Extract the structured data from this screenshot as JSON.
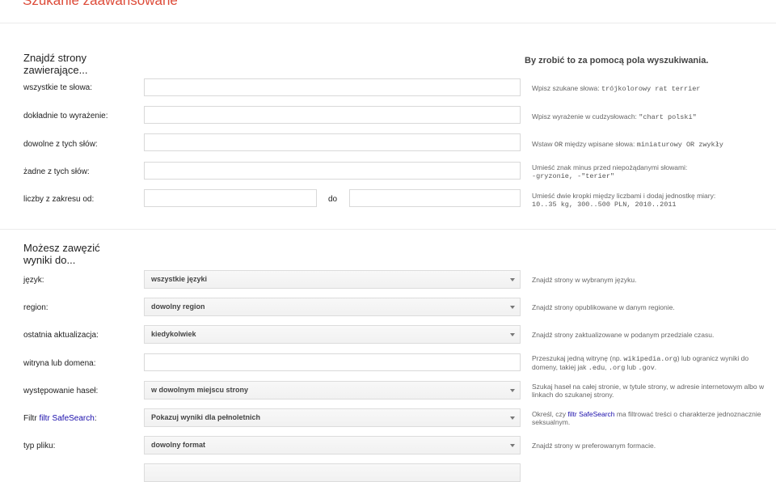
{
  "page": {
    "title": "Szukanie zaawansowane"
  },
  "find_section": {
    "heading": "Znajdź strony zawierające...",
    "right_heading": "By zrobić to za pomocą pola wyszukiwania.",
    "rows": [
      {
        "label": "wszystkie te słowa:",
        "hint_prefix": "Wpisz szukane słowa: ",
        "hint_code": "trójkolorowy rat terrier"
      },
      {
        "label": "dokładnie to wyrażenie:",
        "hint_prefix": "Wpisz wyrażenie w cudzysłowach: ",
        "hint_code": "\"chart polski\""
      },
      {
        "label": "dowolne z tych słów:",
        "hint_prefix": "Wstaw ",
        "hint_code": "OR",
        "hint_middle": " między wpisane słowa: ",
        "hint_code2": "miniaturowy OR zwykły"
      },
      {
        "label": "żadne z tych słów:",
        "hint_prefix": "Umieść znak minus przed niepożądanymi słowami:",
        "hint_code": "-gryzonie, -\"terier\""
      },
      {
        "label": "liczby z zakresu od:",
        "to_label": "do",
        "hint_prefix": "Umieść dwie kropki między liczbami i dodaj jednostkę miary:",
        "hint_code": "10..35 kg, 300..500 PLN, 2010..2011"
      }
    ]
  },
  "narrow_section": {
    "heading": "Możesz zawęzić wyniki do...",
    "rows": [
      {
        "label": "język:",
        "value": "wszystkie języki",
        "hint": "Znajdź strony w wybranym języku."
      },
      {
        "label": "region:",
        "value": "dowolny region",
        "hint": "Znajdź strony opublikowane w danym regionie."
      },
      {
        "label": "ostatnia aktualizacja:",
        "value": "kiedykolwiek",
        "hint": "Znajdź strony zaktualizowane w podanym przedziale czasu."
      },
      {
        "label": "witryna lub domena:",
        "hint_prefix": "Przeszukaj jedną witrynę (np. ",
        "hint_code": "wikipedia.org",
        "hint_middle": ") lub ogranicz wyniki do domeny, takiej jak ",
        "hint_code2": ".edu",
        "hint_sep": ", ",
        "hint_code3": ".org",
        "hint_sep2": " lub ",
        "hint_code4": ".gov",
        "hint_end": "."
      },
      {
        "label": "występowanie haseł:",
        "value": "w dowolnym miejscu strony",
        "hint": "Szukaj haseł na całej stronie, w tytule strony, w adresie internetowym albo w linkach do szukanej strony."
      },
      {
        "label_prefix": "Filtr ",
        "label_link": "filtr SafeSearch",
        "label_suffix": ":",
        "value": "Pokazuj wyniki dla pełnoletnich",
        "hint_prefix": "Określ, czy ",
        "hint_link": "filtr SafeSearch",
        "hint_end": " ma filtrować treści o charakterze jednoznacznie seksualnym."
      },
      {
        "label": "typ pliku:",
        "value": "dowolny format",
        "hint": "Znajdź strony w preferowanym formacie."
      }
    ]
  },
  "icons": {
    "dropdown": "chevron-down-icon"
  }
}
